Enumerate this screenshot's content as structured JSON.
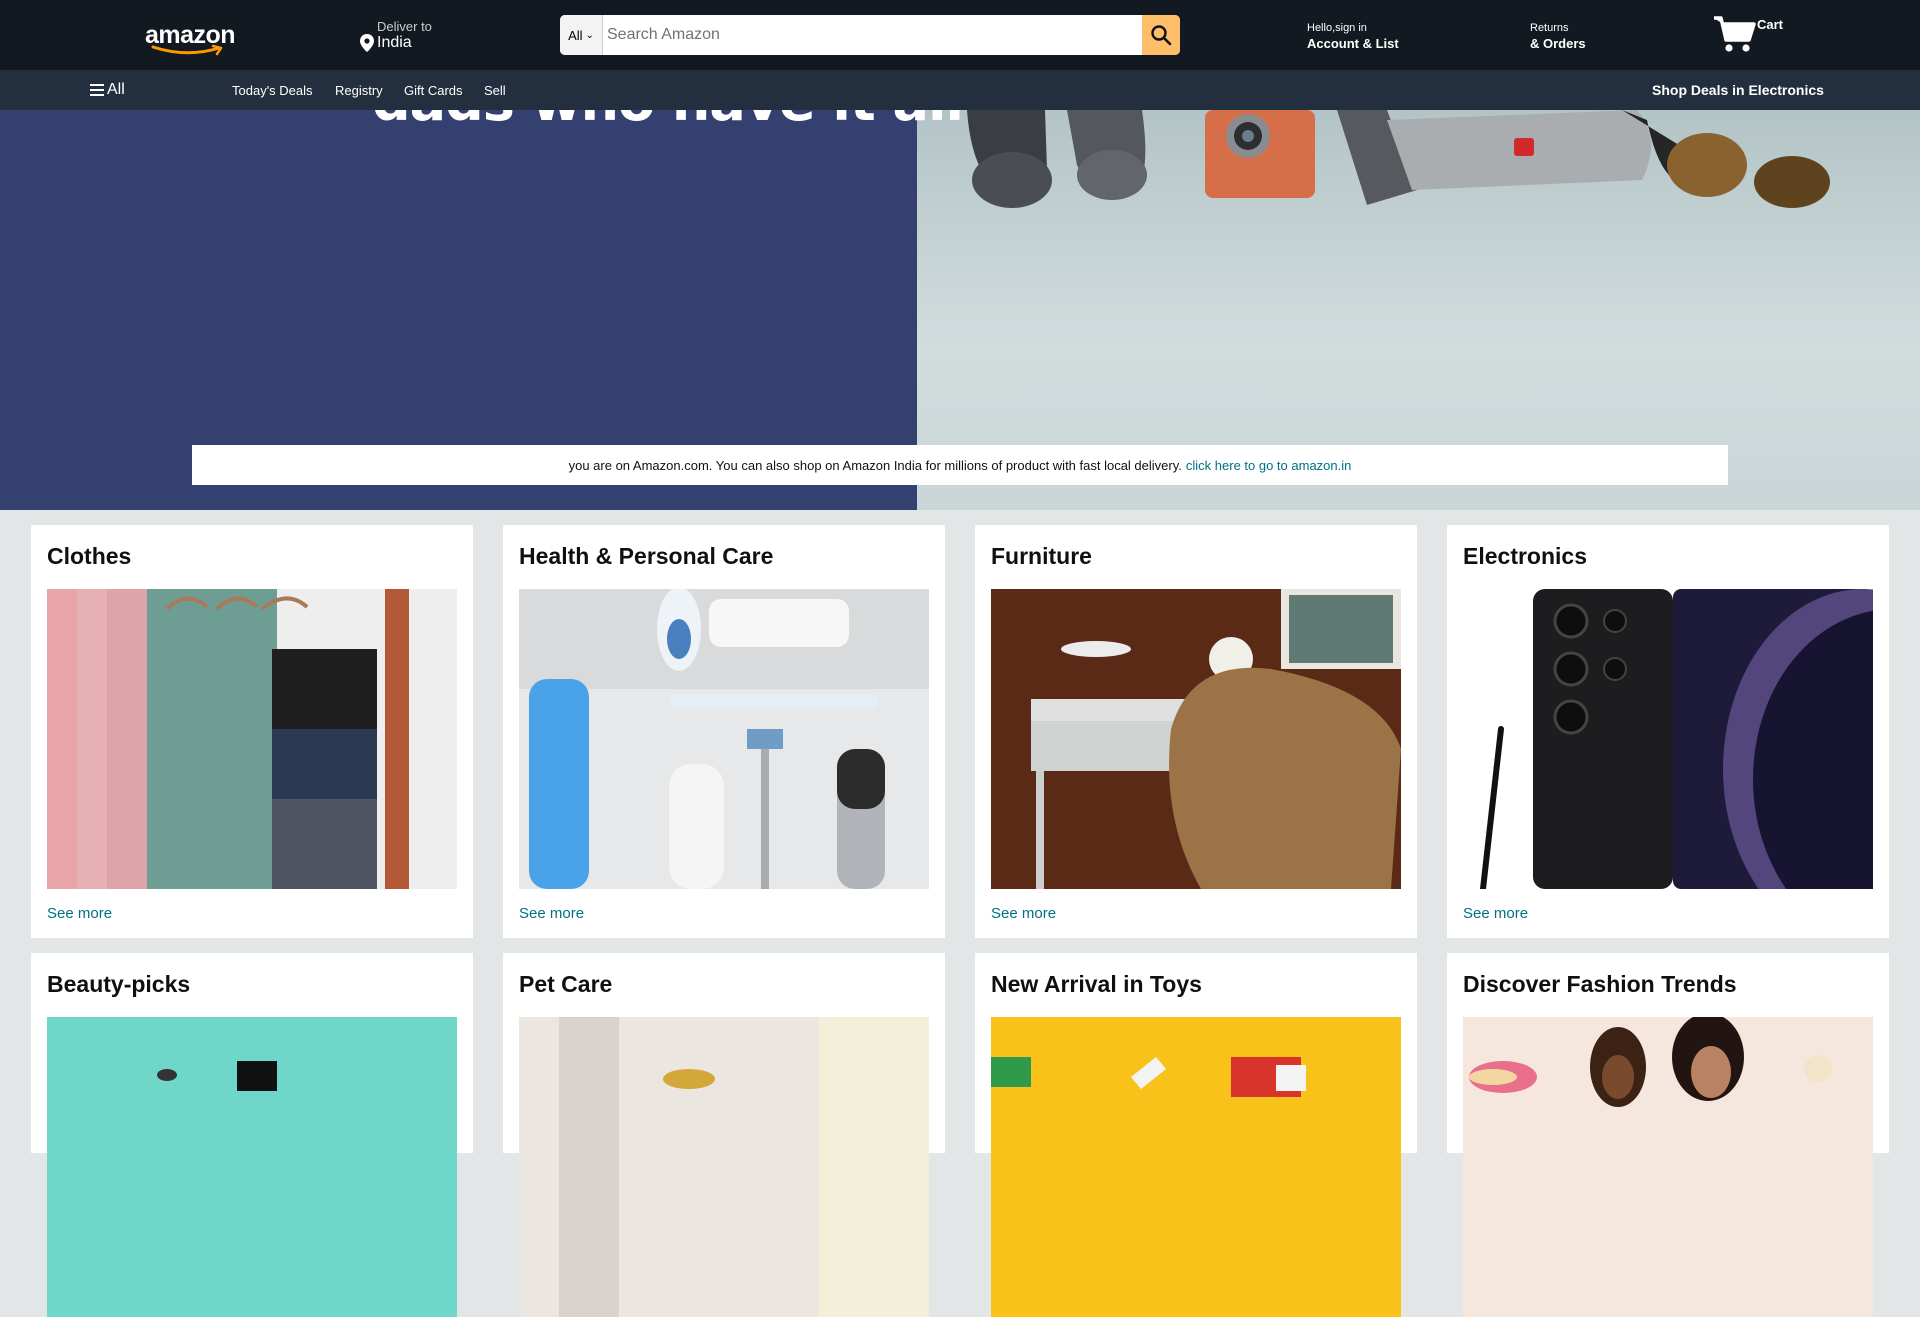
{
  "header": {
    "logo_text": "amazon",
    "deliver_label": "Deliver to",
    "deliver_country": "India",
    "search": {
      "category": "All",
      "placeholder": "Search Amazon"
    },
    "account": {
      "line1": "Hello,sign in",
      "line2": "Account & List"
    },
    "returns": {
      "line1": "Returns",
      "line2": "& Orders"
    },
    "cart_label": "Cart"
  },
  "nav": {
    "all_label": "All",
    "links": [
      "Today's Deals",
      "Registry",
      "Gift Cards",
      "Sell"
    ],
    "deals_label": "Shop Deals in Electronics"
  },
  "hero": {
    "headline": "dads who have it all",
    "notice_text": "you are on Amazon.com. You can also shop on Amazon India for millions of product with fast local delivery.",
    "notice_link": "click here to go to amazon.in"
  },
  "cards": [
    {
      "title": "Clothes",
      "link": "See more"
    },
    {
      "title": "Health & Personal Care",
      "link": "See more"
    },
    {
      "title": "Furniture",
      "link": "See more"
    },
    {
      "title": "Electronics",
      "link": "See more"
    },
    {
      "title": "Beauty-picks"
    },
    {
      "title": "Pet Care"
    },
    {
      "title": "New Arrival in Toys"
    },
    {
      "title": "Discover Fashion Trends"
    }
  ],
  "colors": {
    "header_bg": "#131921",
    "nav_bg": "#232f3e",
    "search_button": "#febd69",
    "hero_left": "#334070",
    "link": "#007185",
    "page_bg": "#e3e6e6"
  }
}
